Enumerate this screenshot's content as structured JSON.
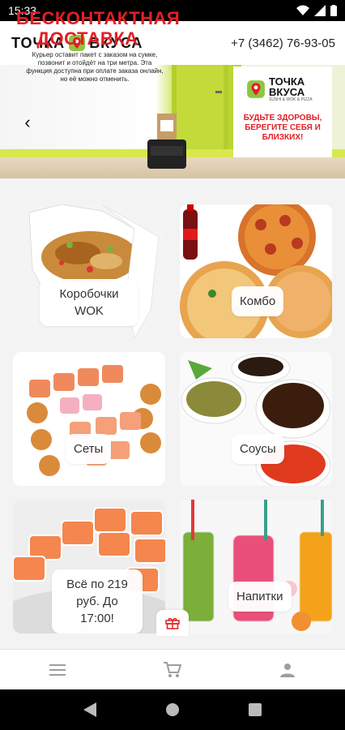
{
  "status_bar": {
    "time": "15:33"
  },
  "header": {
    "logo_left": "ТОЧКА",
    "logo_right": "ВКУСА",
    "phone": "+7 (3462) 76-93-05"
  },
  "banner": {
    "title_line1": "БЕСКОНТАКТНАЯ",
    "title_line2": "ДОСТАВКА",
    "text": "Курьер оставит пакет с заказом на сумке, позвонит и отойдёт на три метра. Эта функция доступна при оплате заказа онлайн, но её можно отменить.",
    "logo_line1": "ТОЧКА",
    "logo_line2": "ВКУСА",
    "logo_sub": "SUSHI & WOK & PIZZA",
    "slogan": "БУДЬТЕ ЗДОРОВЫ, БЕРЕГИТЕ СЕБЯ И БЛИЗКИХ!",
    "bag_label": "ТОЧКА ВКУСА"
  },
  "categories": [
    {
      "label_line1": "Коробочки",
      "label_line2": "WOK"
    },
    {
      "label_line1": "Комбо"
    },
    {
      "label_line1": "Сеты"
    },
    {
      "label_line1": "Соусы"
    },
    {
      "label_line1": "Всё по 219",
      "label_line2": "руб. До 17:00!"
    },
    {
      "label_line1": "Напитки"
    }
  ],
  "colors": {
    "brand_red": "#e31e24",
    "brand_green": "#8dc63f"
  },
  "icons": {
    "menu": "menu-icon",
    "cart": "cart-icon",
    "profile": "profile-icon",
    "gift": "gift-icon"
  }
}
